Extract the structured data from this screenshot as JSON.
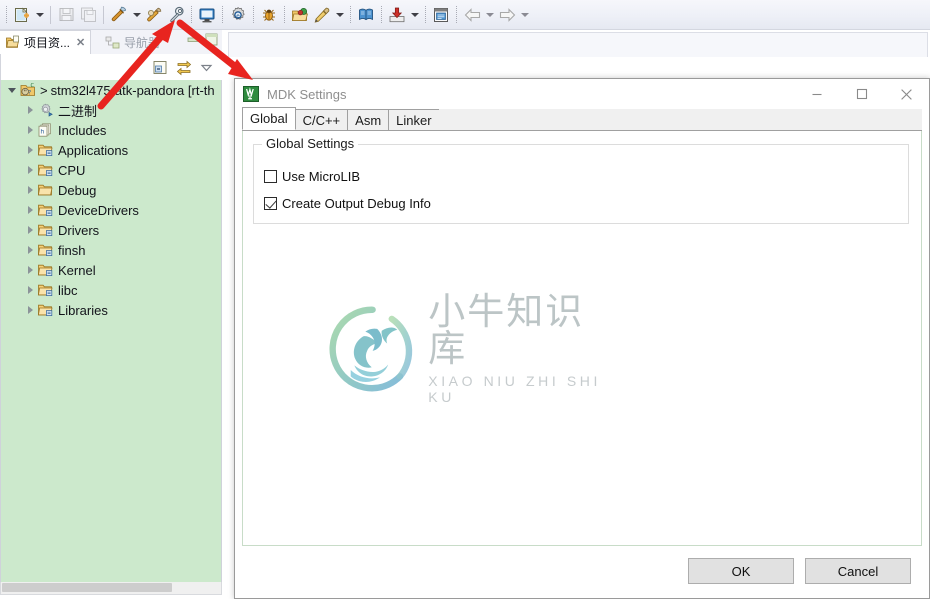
{
  "toolbar": {
    "items": [
      {
        "name": "new-wizard-button",
        "icon": "new-file-icon",
        "has_dropdown": true
      },
      {
        "name": "save-button",
        "icon": "save-icon",
        "has_dropdown": false
      },
      {
        "name": "save-all-button",
        "icon": "save-all-icon",
        "has_dropdown": false
      },
      {
        "name": "build-button",
        "icon": "hammer-icon",
        "has_dropdown": true
      },
      {
        "name": "clean-button",
        "icon": "hammer-alt-icon",
        "has_dropdown": false
      },
      {
        "name": "settings-button",
        "icon": "wrench-icon",
        "has_dropdown": false
      },
      {
        "name": "terminal-button",
        "icon": "console-icon",
        "has_dropdown": false
      },
      {
        "name": "config-button",
        "icon": "gear-icon",
        "has_dropdown": false
      },
      {
        "name": "debug-button",
        "icon": "bug-icon",
        "has_dropdown": false
      },
      {
        "name": "open-package-button",
        "icon": "package-folder-icon",
        "has_dropdown": false
      },
      {
        "name": "flash-button",
        "icon": "pencil-icon",
        "has_dropdown": true
      },
      {
        "name": "docs-button",
        "icon": "book-icon",
        "has_dropdown": false
      },
      {
        "name": "download-button",
        "icon": "download-icon",
        "has_dropdown": true
      },
      {
        "name": "report-button",
        "icon": "report-icon",
        "has_dropdown": false
      },
      {
        "name": "back-button",
        "icon": "back-arrow-icon",
        "has_dropdown": true
      },
      {
        "name": "forward-button",
        "icon": "forward-arrow-icon",
        "has_dropdown": true
      }
    ]
  },
  "left_view": {
    "tabs": [
      {
        "label": "项目资...",
        "active": true,
        "close_glyph": "✕"
      },
      {
        "label": "导航器",
        "active": false,
        "close_glyph": ""
      }
    ],
    "view_tools": [
      {
        "name": "collapse-all-button",
        "icon": "collapse-all-icon"
      },
      {
        "name": "link-with-editor-button",
        "icon": "link-editor-icon"
      },
      {
        "name": "view-menu-button",
        "icon": "chevron-down-icon"
      }
    ],
    "tree": {
      "root": {
        "label": "stm32l475-atk-pandora [rt-th",
        "prefix": ">",
        "icon": "project-c-icon",
        "expanded": true
      },
      "children": [
        {
          "label": "二进制",
          "icon": "binaries-icon"
        },
        {
          "label": "Includes",
          "icon": "includes-icon"
        },
        {
          "label": "Applications",
          "icon": "source-folder-icon"
        },
        {
          "label": "CPU",
          "icon": "source-folder-icon"
        },
        {
          "label": "Debug",
          "icon": "plain-folder-icon"
        },
        {
          "label": "DeviceDrivers",
          "icon": "source-folder-icon"
        },
        {
          "label": "Drivers",
          "icon": "source-folder-icon"
        },
        {
          "label": "finsh",
          "icon": "source-folder-icon"
        },
        {
          "label": "Kernel",
          "icon": "source-folder-icon"
        },
        {
          "label": "libc",
          "icon": "source-folder-icon"
        },
        {
          "label": "Libraries",
          "icon": "source-folder-icon"
        }
      ]
    }
  },
  "dialog": {
    "title": "MDK Settings",
    "app_icon": "rt-thread-logo-icon",
    "window_buttons": [
      {
        "name": "minimize-button",
        "glyph": "minimize-icon"
      },
      {
        "name": "maximize-button",
        "glyph": "maximize-icon"
      },
      {
        "name": "close-button",
        "glyph": "close-icon"
      }
    ],
    "tabs": [
      {
        "label": "Global",
        "active": true
      },
      {
        "label": "C/C++",
        "active": false
      },
      {
        "label": "Asm",
        "active": false
      },
      {
        "label": "Linker",
        "active": false
      }
    ],
    "group": {
      "legend": "Global Settings",
      "checkboxes": [
        {
          "label": "Use MicroLIB",
          "checked": false
        },
        {
          "label": "Create Output Debug Info",
          "checked": true
        }
      ]
    },
    "watermark": {
      "cn": "小牛知识库",
      "en": "XIAO NIU ZHI SHI KU",
      "logo_icon": "ox-circle-logo-icon"
    },
    "buttons": {
      "ok": "OK",
      "cancel": "Cancel"
    }
  },
  "annotations": {
    "arrow_color": "#e8241f",
    "arrows": [
      {
        "name": "arrow-to-settings-button",
        "from": [
          101,
          106
        ],
        "to": [
          172,
          24
        ]
      },
      {
        "name": "arrow-to-dialog",
        "from": [
          179,
          22
        ],
        "to": [
          249,
          79
        ]
      }
    ]
  },
  "colors": {
    "tree_background": "#cce9cc",
    "toolbar_background": "#eef0f7",
    "dialog_background": "#ffffff",
    "button_face": "#e1e1e1",
    "accent_red": "#e8241f"
  }
}
